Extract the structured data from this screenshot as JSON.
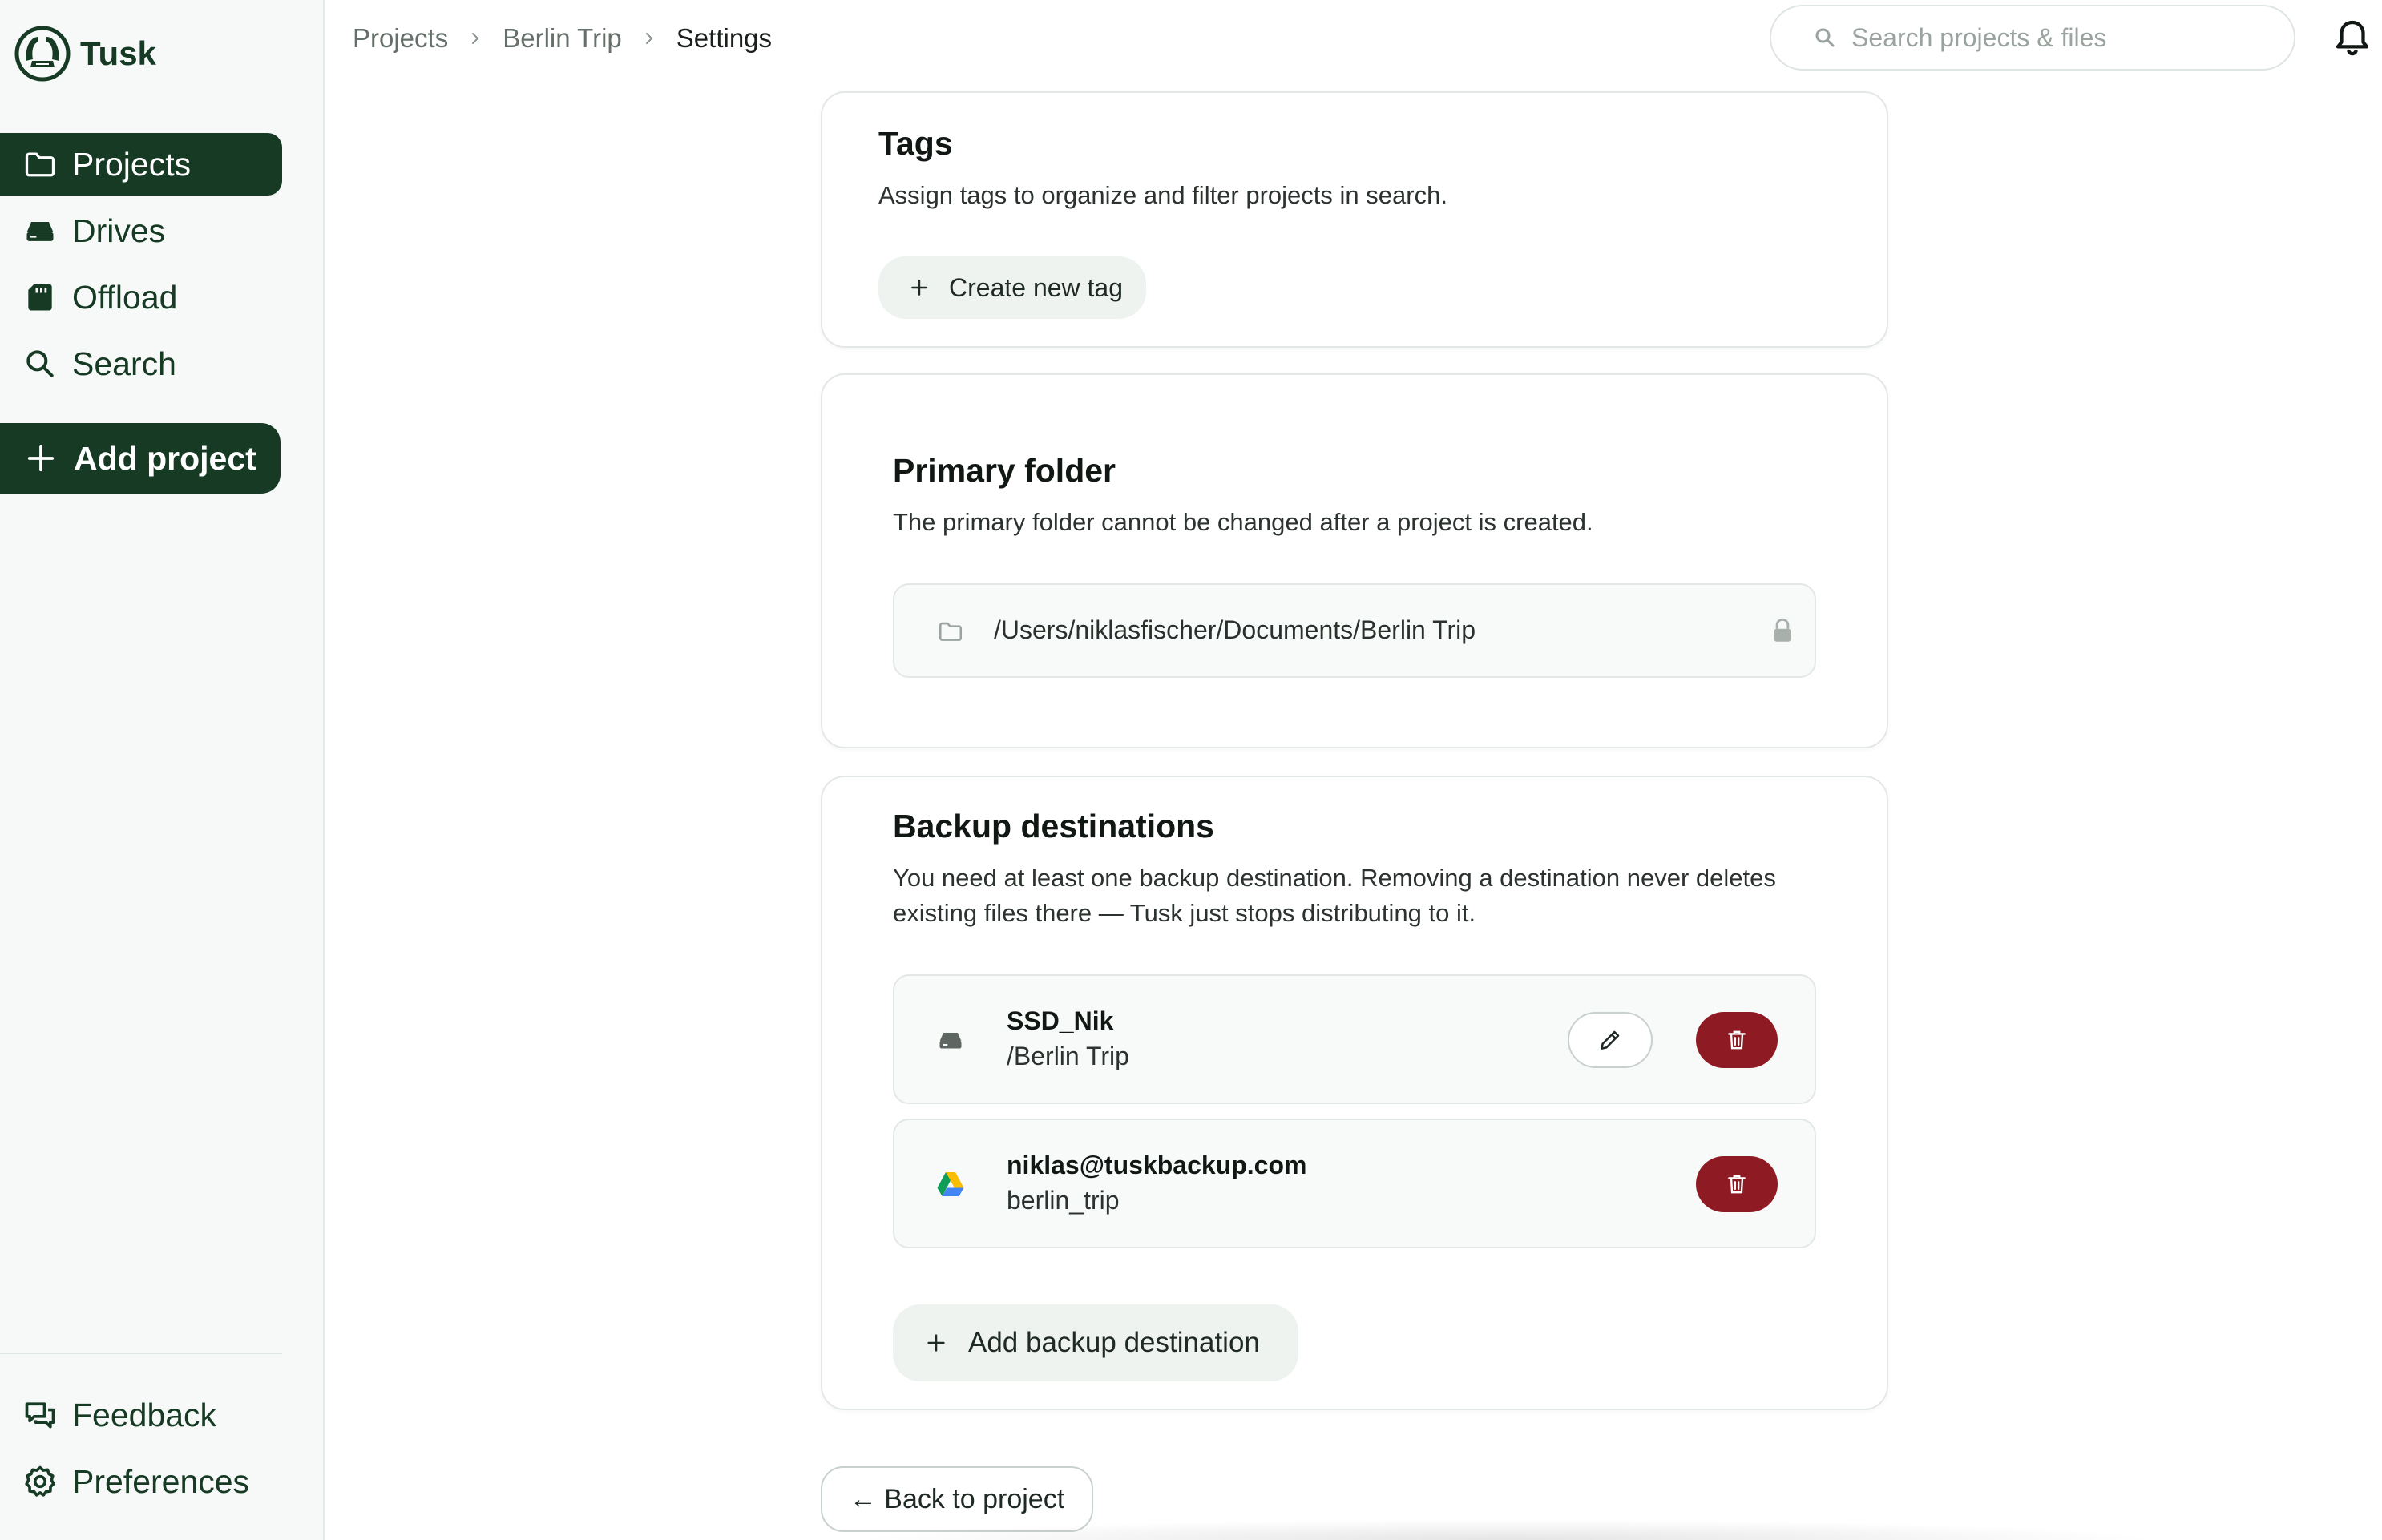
{
  "app": {
    "name": "Tusk"
  },
  "sidebar": {
    "items": [
      {
        "label": "Projects",
        "icon": "folder-icon",
        "active": true
      },
      {
        "label": "Drives",
        "icon": "drive-icon",
        "active": false
      },
      {
        "label": "Offload",
        "icon": "sd-card-icon",
        "active": false
      },
      {
        "label": "Search",
        "icon": "search-icon",
        "active": false
      }
    ],
    "add_project": "Add project",
    "bottom_items": [
      {
        "label": "Feedback",
        "icon": "chat-bubbles-icon"
      },
      {
        "label": "Preferences",
        "icon": "gear-icon"
      }
    ]
  },
  "breadcrumb": {
    "items": [
      "Projects",
      "Berlin Trip"
    ],
    "current": "Settings"
  },
  "search": {
    "placeholder": "Search projects & files",
    "value": ""
  },
  "tags": {
    "title": "Tags",
    "description": "Assign tags to organize and filter projects in search.",
    "create_label": "Create new tag"
  },
  "primary_folder": {
    "title": "Primary folder",
    "description": "The primary folder cannot be changed after a project is created.",
    "path": "/Users/niklasfischer/Documents/Berlin Trip"
  },
  "backup": {
    "title": "Backup destinations",
    "description_line1": "You need at least one backup destination. Removing a destination never deletes",
    "description_line2": "existing files there — Tusk just stops distributing to it.",
    "destinations": [
      {
        "name": "SSD_Nik",
        "path": "/Berlin Trip",
        "icon": "drive-icon",
        "editable": true
      },
      {
        "name": "niklas@tuskbackup.com",
        "path": "berlin_trip",
        "icon": "google-drive-icon",
        "editable": false
      }
    ],
    "add_label": "Add backup destination"
  },
  "footer": {
    "back_label": "← Back to project"
  },
  "colors": {
    "brand_dark_green": "#163a24",
    "danger_red": "#8e1a24",
    "soft_green_bg": "#eef3f0"
  }
}
